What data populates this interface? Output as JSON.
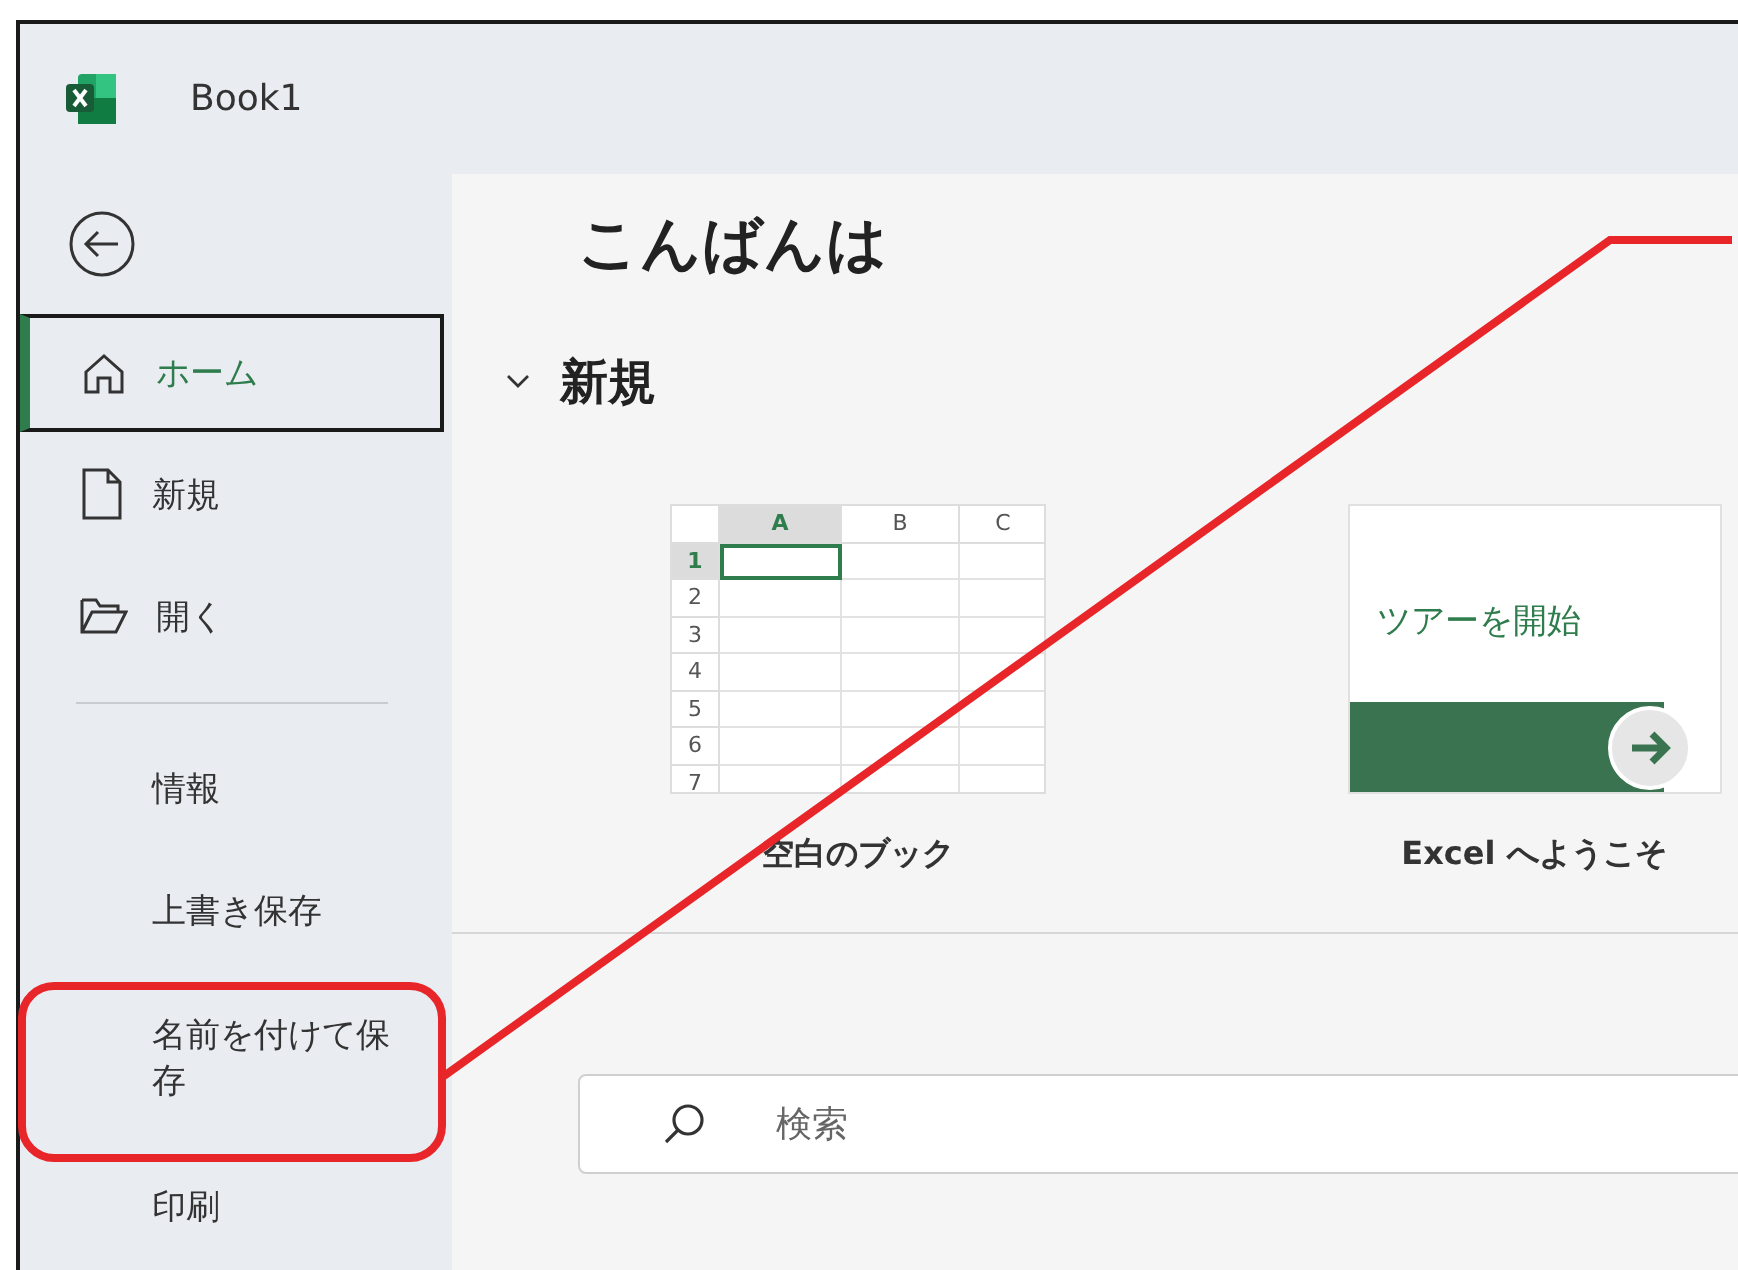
{
  "window": {
    "title": "Book1"
  },
  "sidebar": {
    "primary_items": [
      {
        "label": "ホーム",
        "selected": true
      },
      {
        "label": "新規",
        "selected": false
      },
      {
        "label": "開く",
        "selected": false
      }
    ],
    "secondary_items": [
      {
        "label": "情報",
        "selected": false
      },
      {
        "label": "上書き保存",
        "selected": false
      },
      {
        "label": "名前を付けて保存",
        "selected": false
      },
      {
        "label": "印刷",
        "selected": false
      }
    ]
  },
  "content": {
    "greeting": "こんばんは",
    "new_section": {
      "title": "新規",
      "expanded": true
    },
    "templates": [
      {
        "kind": "blank",
        "label": "空白のブック",
        "columns": [
          "A",
          "B",
          "C"
        ],
        "rows": [
          "1",
          "2",
          "3",
          "4",
          "5",
          "6",
          "7"
        ]
      },
      {
        "kind": "tour",
        "label": "Excel へようこそ",
        "card_text": "ツアーを開始"
      }
    ],
    "search": {
      "placeholder": "検索"
    }
  }
}
